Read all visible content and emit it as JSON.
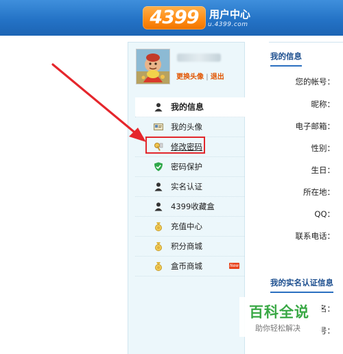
{
  "header": {
    "logo_number": "4399",
    "logo_title": "用户中心",
    "logo_url": "u.4399.com"
  },
  "profile": {
    "change_avatar_link": "更换头像",
    "separator": "|",
    "logout_link": "退出"
  },
  "menu": {
    "items": [
      {
        "label": "我的信息",
        "icon": "person-icon"
      },
      {
        "label": "我的头像",
        "icon": "image-icon"
      },
      {
        "label": "修改密码",
        "icon": "key-icon"
      },
      {
        "label": "密码保护",
        "icon": "shield-check-icon"
      },
      {
        "label": "实名认证",
        "icon": "person-icon"
      },
      {
        "label": "4399收藏盒",
        "icon": "person-icon"
      },
      {
        "label": "充值中心",
        "icon": "coin-icon"
      },
      {
        "label": "积分商城",
        "icon": "coin-icon"
      },
      {
        "label": "盒币商城",
        "icon": "coin-icon",
        "badge": "New"
      }
    ]
  },
  "info_section": {
    "title": "我的信息",
    "fields": [
      {
        "label": "您的帐号："
      },
      {
        "label": "昵称："
      },
      {
        "label": "电子邮箱："
      },
      {
        "label": "性别："
      },
      {
        "label": "生日："
      },
      {
        "label": "所在地："
      },
      {
        "label": "QQ："
      },
      {
        "label": "联系电话："
      }
    ]
  },
  "realname_section": {
    "title": "我的实名认证信息",
    "fields": [
      {
        "label": "名："
      },
      {
        "label": "号："
      }
    ]
  },
  "watermark": {
    "title": "百科全说",
    "subtitle": "助你轻松解决"
  },
  "colors": {
    "header_blue": "#2473c6",
    "logo_orange": "#ff8a12",
    "link_orange": "#e15500",
    "highlight_red": "#e2262b",
    "section_title_blue": "#1d4f8f",
    "watermark_green": "#39a845"
  }
}
